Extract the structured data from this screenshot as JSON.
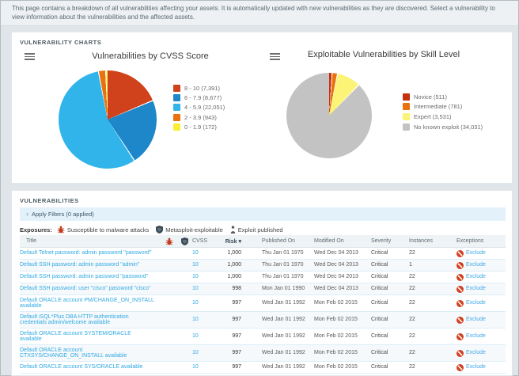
{
  "banner": {
    "text": "This page contains a breakdown of all vulnerabilities affecting your assets. It is automatically updated with new vulnerabilities as they are discovered. Select a vulnerability to view information about the vulnerabilities and the affected assets."
  },
  "charts_panel": {
    "title": "VULNERABILITY CHARTS"
  },
  "chart_data": [
    {
      "type": "pie",
      "title": "Vulnerabilities by CVSS Score",
      "labels": [
        "8 - 10 (7,391)",
        "6 - 7.9 (8,677)",
        "4 - 5.9 (22,051)",
        "2 - 3.9 (943)",
        "0 - 1.9 (172)"
      ],
      "values": [
        7391,
        8677,
        22051,
        943,
        172
      ],
      "colors": [
        "#d0421c",
        "#1d87c9",
        "#30b4ea",
        "#e8730e",
        "#f9ee32"
      ],
      "legend_position": "right"
    },
    {
      "type": "pie",
      "title": "Exploitable Vulnerabilities by Skill Level",
      "labels": [
        "Novice (511)",
        "Intermediate (781)",
        "Expert (3,531)",
        "No known exploit (34,031)"
      ],
      "values": [
        511,
        781,
        3531,
        34031
      ],
      "colors": [
        "#c53010",
        "#e8720e",
        "#fbf477",
        "#c3c3c3"
      ],
      "legend_position": "right"
    }
  ],
  "vulns": {
    "title": "VULNERABILITIES",
    "filters_label": "Apply Filters (0 applied)",
    "exposures": {
      "label": "Exposures:",
      "items": [
        {
          "icon": "bug-icon",
          "label": "Susceptible to malware attacks"
        },
        {
          "icon": "metasploit-shield-icon",
          "label": "Metasploit-exploitable"
        },
        {
          "icon": "exploit-published-icon",
          "label": "Exploit published"
        }
      ]
    },
    "table": {
      "headers": {
        "title": "Title",
        "cvss": "CVSS",
        "risk": "Risk",
        "sort_indicator": "▾",
        "published": "Published On",
        "modified": "Modified On",
        "severity": "Severity",
        "instances": "Instances",
        "exceptions": "Exceptions"
      },
      "rows": [
        {
          "title": "Default Telnet password: admin password \"password\"",
          "cvss": "10",
          "risk": "1,000",
          "published": "Thu Jan 01 1970",
          "modified": "Wed Dec 04 2013",
          "severity": "Critical",
          "instances": "22",
          "exception": "Exclude"
        },
        {
          "title": "Default SSH password: admin password \"admin\"",
          "cvss": "10",
          "risk": "1,000",
          "published": "Thu Jan 01 1970",
          "modified": "Wed Dec 04 2013",
          "severity": "Critical",
          "instances": "1",
          "exception": "Exclude"
        },
        {
          "title": "Default SSH password: admin password \"password\"",
          "cvss": "10",
          "risk": "1,000",
          "published": "Thu Jan 01 1970",
          "modified": "Wed Dec 04 2013",
          "severity": "Critical",
          "instances": "22",
          "exception": "Exclude"
        },
        {
          "title": "Default SSH password: user \"cisco\" password \"cisco\"",
          "cvss": "10",
          "risk": "998",
          "published": "Mon Jan 01 1990",
          "modified": "Wed Dec 04 2013",
          "severity": "Critical",
          "instances": "22",
          "exception": "Exclude"
        },
        {
          "title": "Default ORACLE account PM/CHANGE_ON_INSTALL available",
          "cvss": "10",
          "risk": "997",
          "published": "Wed Jan 01 1992",
          "modified": "Mon Feb 02 2015",
          "severity": "Critical",
          "instances": "22",
          "exception": "Exclude"
        },
        {
          "title": "Default iSQL*Plus DBA HTTP authentication credentials admin/welcome available",
          "cvss": "10",
          "risk": "997",
          "published": "Wed Jan 01 1992",
          "modified": "Mon Feb 02 2015",
          "severity": "Critical",
          "instances": "22",
          "exception": "Exclude"
        },
        {
          "title": "Default ORACLE account SYSTEM/ORACLE available",
          "cvss": "10",
          "risk": "997",
          "published": "Wed Jan 01 1992",
          "modified": "Mon Feb 02 2015",
          "severity": "Critical",
          "instances": "22",
          "exception": "Exclude"
        },
        {
          "title": "Default ORACLE account CTXSYS/CHANGE_ON_INSTALL available",
          "cvss": "10",
          "risk": "997",
          "published": "Wed Jan 01 1992",
          "modified": "Mon Feb 02 2015",
          "severity": "Critical",
          "instances": "22",
          "exception": "Exclude"
        },
        {
          "title": "Default ORACLE account SYS/ORACLE available",
          "cvss": "10",
          "risk": "997",
          "published": "Wed Jan 01 1992",
          "modified": "Mon Feb 02 2015",
          "severity": "Critical",
          "instances": "22",
          "exception": "Exclude"
        }
      ]
    }
  }
}
